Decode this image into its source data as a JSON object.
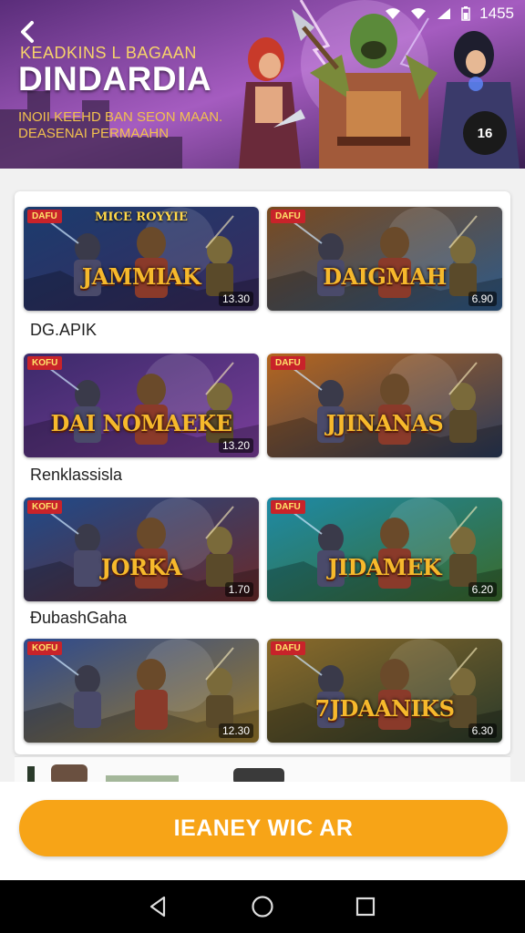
{
  "status_bar": {
    "time": "1455"
  },
  "hero": {
    "back_icon": "chevron-left-icon",
    "subtitle": "KEADKINS L BAGAAN",
    "title": "DINDARDIA",
    "desc_line1": "INOII KEEHD BAN SEON MAAN.",
    "desc_line2": "DEASENAI PERMAAHN",
    "badge": "16"
  },
  "tiles": [
    {
      "tag": "DAFU",
      "top": "MICE ROYYIE",
      "title": "JAMMIAK",
      "num": "13.30",
      "colors": [
        "#1b3c6e",
        "#3a2a5e"
      ]
    },
    {
      "tag": "DAFU",
      "top": "",
      "title": "DAIGMAH",
      "num": "6.90",
      "colors": [
        "#7a4a1e",
        "#2d5a8a"
      ]
    },
    {
      "tag": "KOFU",
      "top": "",
      "title": "DAI NOMAEKE",
      "num": "13.20",
      "colors": [
        "#3b2a6a",
        "#7a3e9a"
      ]
    },
    {
      "tag": "DAFU",
      "top": "",
      "title": "JJINANAS",
      "num": "",
      "colors": [
        "#b5661f",
        "#2a3a5a"
      ]
    },
    {
      "tag": "KOFU",
      "top": "",
      "title": "JORKA",
      "num": "1.70",
      "colors": [
        "#1f4a8a",
        "#6a2a2a"
      ]
    },
    {
      "tag": "DAFU",
      "top": "",
      "title": "JIDAMEK",
      "num": "6.20",
      "colors": [
        "#1e8aa6",
        "#3a6a2a"
      ]
    },
    {
      "tag": "KOFU",
      "top": "",
      "title": "",
      "num": "12.30",
      "colors": [
        "#2e4a8e",
        "#9a7a2a"
      ]
    },
    {
      "tag": "DAFU",
      "top": "",
      "title": "7JDAANIKS",
      "num": "6.30",
      "colors": [
        "#8a6a2a",
        "#2a3a2a"
      ]
    }
  ],
  "sections": [
    "DG.APIK",
    "Renklassisla",
    "ÐubashGaha"
  ],
  "primary_button": {
    "label": "IEANEY WIC AR"
  },
  "nav": {
    "back": "back-triangle-icon",
    "home": "home-circle-icon",
    "recents": "recents-square-icon"
  },
  "colors": {
    "accent": "#f7a417",
    "hero_purple": "#8b4aa6",
    "tag_red": "#c8232a"
  }
}
